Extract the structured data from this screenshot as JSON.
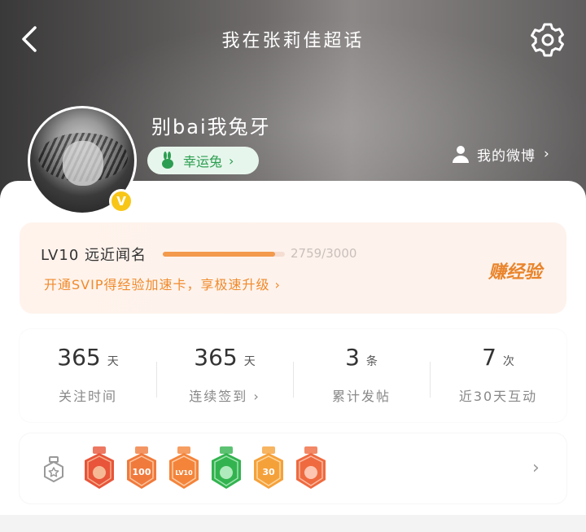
{
  "header": {
    "title": "我在张莉佳超话",
    "username": "别bai我兔牙",
    "lucky_tag": "幸运兔",
    "lucky_tag_chevron": "›",
    "my_weibo": "我的微博",
    "my_weibo_chevron": "›",
    "verified_badge": "V"
  },
  "experience": {
    "level_name": "LV10 远近闻名",
    "progress_text": "2759/3000",
    "progress_fraction": 0.9197,
    "svip_link": "开通SVIP得经验加速卡，享极速升级 ›",
    "earn_button": "赚经验"
  },
  "stats": [
    {
      "num": "365",
      "unit": "天",
      "label": "关注时间"
    },
    {
      "num": "365",
      "unit": "天",
      "label": "连续签到 ›"
    },
    {
      "num": "3",
      "unit": "条",
      "label": "累计发帖"
    },
    {
      "num": "7",
      "unit": "次",
      "label": "近30天互动"
    }
  ],
  "badges": {
    "items": [
      {
        "name": "cat-badge",
        "color": "#e8553a",
        "accent": "#f7c4a0"
      },
      {
        "name": "100-days-badge",
        "color": "#f07a3c",
        "accent": "#ffd7b8",
        "text": "100"
      },
      {
        "name": "lv10-badge",
        "color": "#f4843a",
        "accent": "#ffe2c8",
        "text": "LV10"
      },
      {
        "name": "green-hands-badge",
        "color": "#33b34f",
        "accent": "#bdf0c8"
      },
      {
        "name": "30-days-badge",
        "color": "#f5a13a",
        "accent": "#ffe6bc",
        "text": "30"
      },
      {
        "name": "hand-badge",
        "color": "#ef6a3f",
        "accent": "#ffd0be"
      }
    ],
    "chevron": "›"
  },
  "colors": {
    "accent_orange": "#f08a2b",
    "progress_fill": "#f39a4d",
    "lucky_green": "#2c9e51",
    "verified_yellow": "#f8c617"
  }
}
